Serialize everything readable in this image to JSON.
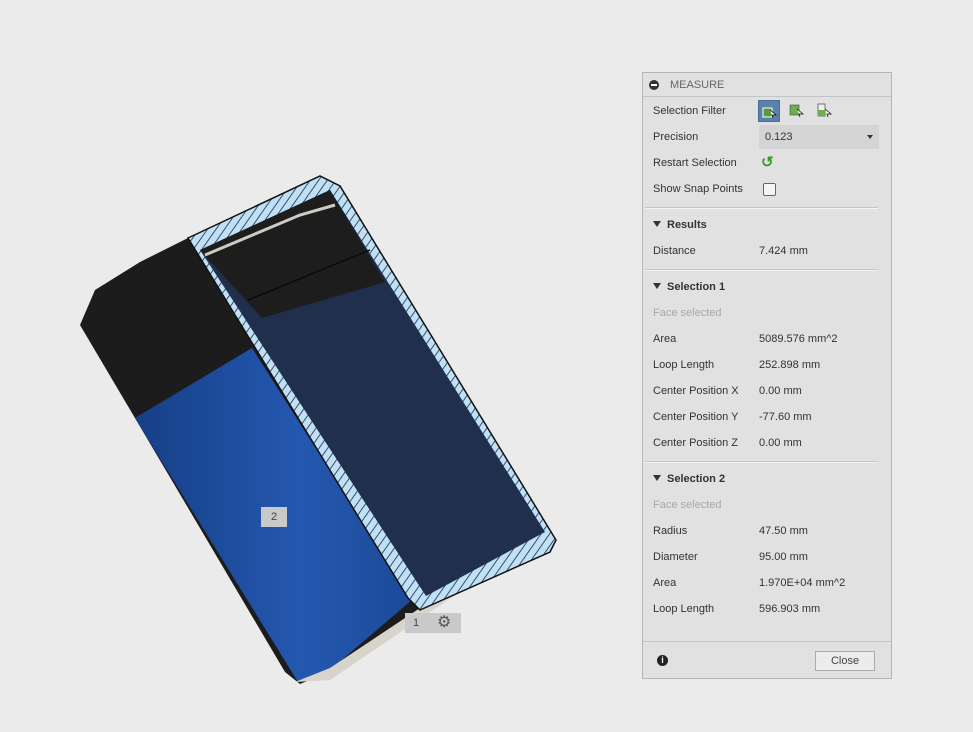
{
  "viewport": {
    "tag1": "1",
    "tag2": "2",
    "gear_icon": "gear-icon"
  },
  "measure": {
    "title": "MEASURE",
    "selection_filter_label": "Selection Filter",
    "precision_label": "Precision",
    "precision_value": "0.123",
    "restart_label": "Restart Selection",
    "snap_label": "Show Snap Points",
    "results": {
      "title": "Results",
      "distance_label": "Distance",
      "distance_value": "7.424 mm"
    },
    "selection1": {
      "title": "Selection 1",
      "status": "Face selected",
      "rows": [
        {
          "label": "Area",
          "value": "5089.576 mm^2"
        },
        {
          "label": "Loop Length",
          "value": "252.898 mm"
        },
        {
          "label": "Center Position X",
          "value": "0.00 mm"
        },
        {
          "label": "Center Position Y",
          "value": "-77.60 mm"
        },
        {
          "label": "Center Position Z",
          "value": "0.00 mm"
        }
      ]
    },
    "selection2": {
      "title": "Selection 2",
      "status": "Face selected",
      "rows": [
        {
          "label": "Radius",
          "value": "47.50 mm"
        },
        {
          "label": "Diameter",
          "value": "95.00 mm"
        },
        {
          "label": "Area",
          "value": "1.970E+04 mm^2"
        },
        {
          "label": "Loop Length",
          "value": "596.903 mm"
        }
      ]
    },
    "close_label": "Close"
  },
  "colors": {
    "blue": "#1e4fa0",
    "accent": "#5a82ad"
  }
}
